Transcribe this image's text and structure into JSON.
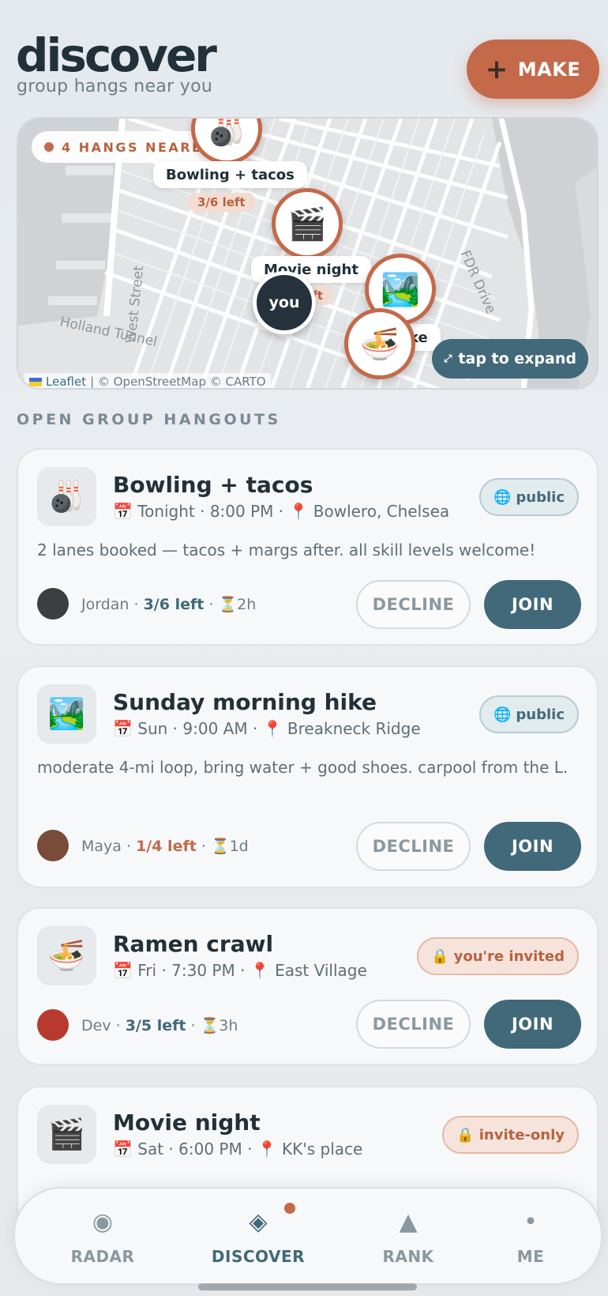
{
  "header": {
    "title": "discover",
    "subtitle": "group hangs near you",
    "make_plus": "+",
    "make_label": "MAKE"
  },
  "map": {
    "nearby_label": "4 HANGS NEARBY",
    "pins": [
      {
        "emoji": "🎳",
        "label": "Bowling + tacos",
        "left": "3/6 left"
      },
      {
        "emoji": "🎬",
        "label": "Movie night",
        "left": "left"
      },
      {
        "emoji": "🏞️",
        "label": "hike",
        "left": ""
      },
      {
        "emoji": "🍜",
        "label": "",
        "left": "t"
      }
    ],
    "you_label": "you",
    "street_labels": [
      "West Street",
      "Holland Tunnel",
      "FDR Drive"
    ],
    "expand_label": "tap to expand",
    "expand_icon": "⤢",
    "attribution_leaflet": "Leaflet",
    "attribution_rest": "| © OpenStreetMap © CARTO"
  },
  "section_label": "OPEN GROUP HANGOUTS",
  "cards": [
    {
      "emoji": "🎳",
      "title": "Bowling + tacos",
      "meta": "📅 Tonight · 8:00 PM · 📍 Bowlero, Chelsea",
      "badge_icon": "🌐",
      "badge": "public",
      "badge_type": "public",
      "desc": "2 lanes booked — tacos + margs after. all skill levels welcome!",
      "host": "Jordan ·",
      "spots": "3/6 left",
      "time_left": "· ⏳2h",
      "decline": "DECLINE",
      "join": "JOIN"
    },
    {
      "emoji": "🏞️",
      "title": "Sunday morning hike",
      "meta": "📅 Sun · 9:00 AM · 📍 Breakneck Ridge",
      "badge_icon": "🌐",
      "badge": "public",
      "badge_type": "public",
      "desc": "moderate 4-mi loop, bring water + good shoes. carpool from the L.",
      "host": "Maya ·",
      "spots": "1/4 left",
      "time_left": "· ⏳1d",
      "decline": "DECLINE",
      "join": "JOIN"
    },
    {
      "emoji": "🍜",
      "title": "Ramen crawl",
      "meta": "📅 Fri · 7:30 PM · 📍 East Village",
      "badge_icon": "🔒",
      "badge": "you're invited",
      "badge_type": "invite",
      "desc": "",
      "host": "Dev ·",
      "spots": "3/5 left",
      "time_left": "· ⏳3h",
      "decline": "DECLINE",
      "join": "JOIN"
    },
    {
      "emoji": "🎬",
      "title": "Movie night",
      "meta": "📅 Sat · 6:00 PM · 📍 KK's place",
      "badge_icon": "🔒",
      "badge": "invite-only",
      "badge_type": "invite"
    }
  ],
  "nav": {
    "items": [
      {
        "label": "RADAR",
        "icon": "◉"
      },
      {
        "label": "DISCOVER",
        "icon": "◈"
      },
      {
        "label": "RANK",
        "icon": "▲"
      },
      {
        "label": "ME",
        "icon": "•"
      }
    ]
  },
  "colors": {
    "accent": "#c4694a",
    "primary": "#41697a",
    "text_dark": "#223039"
  }
}
